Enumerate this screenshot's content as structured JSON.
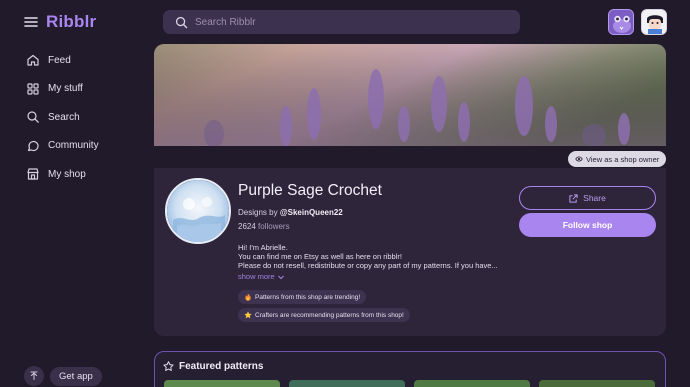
{
  "app": {
    "brand": "Ribblr"
  },
  "sidebar": {
    "items": [
      {
        "label": "Feed",
        "icon": "home-icon"
      },
      {
        "label": "My stuff",
        "icon": "grid-icon"
      },
      {
        "label": "Search",
        "icon": "search-icon"
      },
      {
        "label": "Community",
        "icon": "community-icon"
      },
      {
        "label": "My shop",
        "icon": "shop-icon"
      }
    ],
    "get_app_label": "Get app"
  },
  "search": {
    "placeholder": "Search Ribblr"
  },
  "banner": {
    "owner_view_label": "View as a shop owner"
  },
  "shop": {
    "name": "Purple Sage Crochet",
    "designs_prefix": "Designs by",
    "designer": "@SkeinQueen22",
    "followers_count": "2624",
    "followers_label": "followers",
    "bio_lines": [
      "Hi! I'm Abrielle.",
      "You can find me on Etsy as well as here on ribblr!",
      "Please do not resell, redistribute or copy any part of my patterns. If you have..."
    ],
    "show_more": "show more",
    "badges": [
      {
        "emoji": "fire",
        "label": "Patterns from this shop are trending!"
      },
      {
        "emoji": "star",
        "label": "Crafters are recommending patterns from this shop!"
      }
    ],
    "share_label": "Share",
    "follow_label": "Follow shop"
  },
  "featured": {
    "title": "Featured patterns"
  },
  "colors": {
    "accent": "#a985ef",
    "background": "#211a2b",
    "card": "#2e253a"
  }
}
